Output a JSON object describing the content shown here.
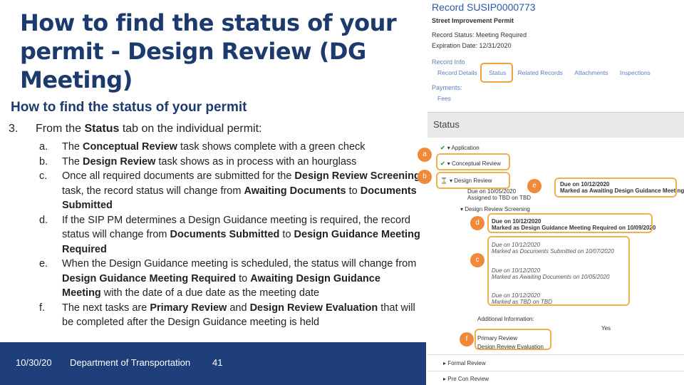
{
  "slide": {
    "title_lines": [
      "How to find the status of your",
      "permit - Design Review (DG",
      "Meeting)"
    ],
    "subtitle": "How to find the status of your permit",
    "step_number": "3.",
    "step_prefix": "From the ",
    "step_bold": "Status",
    "step_suffix": " tab on the individual permit:",
    "items": [
      {
        "letter": "a.",
        "parts": [
          [
            "The ",
            false
          ],
          [
            "Conceptual Review",
            true
          ],
          [
            " task shows complete with a green check",
            false
          ]
        ]
      },
      {
        "letter": "b.",
        "parts": [
          [
            "The ",
            false
          ],
          [
            "Design Review",
            true
          ],
          [
            " task shows as in process with an hourglass",
            false
          ]
        ]
      },
      {
        "letter": "c.",
        "parts": [
          [
            "Once all required documents are submitted for the ",
            false
          ],
          [
            "Design Review Screening",
            true
          ],
          [
            " task, the record status will change from ",
            false
          ],
          [
            "Awaiting Documents",
            true
          ],
          [
            " to ",
            false
          ],
          [
            "Documents Submitted",
            true
          ]
        ]
      },
      {
        "letter": "d.",
        "parts": [
          [
            "If the SIP PM determines a Design Guidance meeting is required, the record status will change from ",
            false
          ],
          [
            "Documents Submitted",
            true
          ],
          [
            " to ",
            false
          ],
          [
            "Design Guidance Meeting Required",
            true
          ]
        ]
      },
      {
        "letter": "e.",
        "parts": [
          [
            "When the Design Guidance meeting is scheduled, the status will change from ",
            false
          ],
          [
            "Design Guidance Meeting Required",
            true
          ],
          [
            " to ",
            false
          ],
          [
            "Awaiting Design Guidance Meeting",
            true
          ],
          [
            " with the date of a due date as the meeting date",
            false
          ]
        ]
      },
      {
        "letter": "f.",
        "parts": [
          [
            "The next tasks are ",
            false
          ],
          [
            "Primary Review",
            true
          ],
          [
            " and ",
            false
          ],
          [
            "Design Review Evaluation",
            true
          ],
          [
            " that will be completed after the Design Guidance meeting is held",
            false
          ]
        ]
      }
    ]
  },
  "footer": {
    "date": "10/30/20",
    "department": "Department of Transportation",
    "page": "41"
  },
  "record": {
    "title": "Record SUSIP0000773",
    "permit_type": "Street Improvement Permit",
    "status": "Record Status: Meeting Required",
    "expiration": "Expiration Date: 12/31/2020",
    "record_info": "Record Info",
    "tabs": [
      "Record Details",
      "Status",
      "Related Records",
      "Attachments",
      "Inspections"
    ],
    "payments": "Payments:",
    "fees": "Fees",
    "status_header": "Status"
  },
  "tasks": {
    "application": "Application",
    "conceptual_review": "Conceptual Review",
    "design_review": "Design Review",
    "due_design_review_1": "Due on 10/05/2020",
    "due_design_review_2": "Assigned to TBD on TBD",
    "due_e_1": "Due on 10/12/2020",
    "due_e_2": "Marked as Awaiting Design Guidance Meeting",
    "screening": "Design Review Screening",
    "due_d_1": "Due on 10/12/2020",
    "due_d_2": "Marked as Design Guidance Meeting Required on 10/09/2020",
    "due_c_1": "Due on 10/12/2020",
    "due_c_2": "Marked as Documents Submitted on 10/07/2020",
    "due_c_3": "Due on 10/12/2020",
    "due_c_4": "Marked as Awaiting Documents on 10/05/2020",
    "due_c_5": "Due on 10/12/2020",
    "due_c_6": "Marked as TBD on TBD",
    "additional_info": "Additional Information:",
    "primary_review": "Primary Review",
    "yes": "Yes",
    "design_review_evaluation": "Design Review Evaluation",
    "formal_review": "Formal Review",
    "pre_con_review": "Pre Con Review"
  },
  "badges": {
    "a": "a",
    "b": "b",
    "c": "c",
    "d": "d",
    "e": "e",
    "f": "f"
  },
  "colors": {
    "title": "#1d3a6e",
    "footer_bg": "#1f3f7a",
    "link_blue": "#2b5aa6",
    "highlight_orange": "#f0a040",
    "badge_orange": "#f08a3a",
    "check_green": "#3a9a3a"
  }
}
